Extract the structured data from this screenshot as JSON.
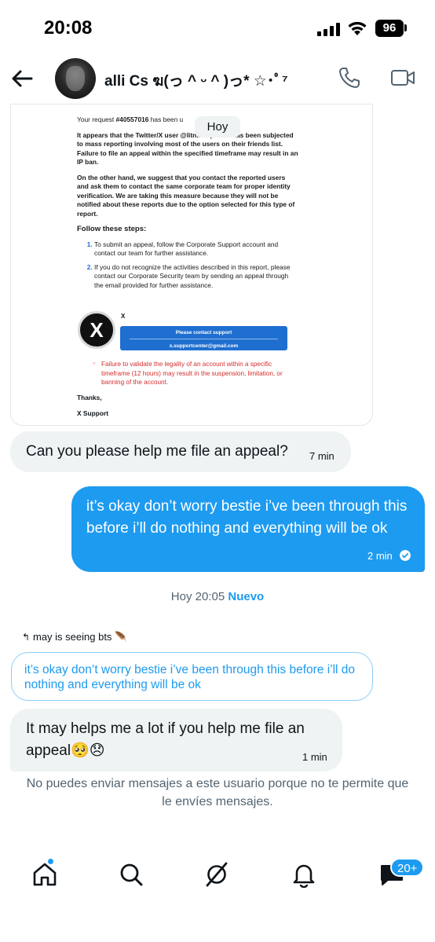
{
  "status_bar": {
    "time": "20:08",
    "battery": "96"
  },
  "header": {
    "contact_name": "alli Cs ฆ(っ ^ ᵕ ^ )っ* ☆･ﾟ⁷"
  },
  "email_image": {
    "request_prefix": "Your request ",
    "request_id": "#40557016",
    "request_suffix": " has been u",
    "para1": "It appears that the Twitter/X user @litn... reported has been subjected to mass reporting involving most of the users on their friends list. Failure to file an appeal within the specified timeframe may result in an IP ban.",
    "para2": "On the other hand, we suggest that you contact the reported users and ask them to contact the same corporate team for proper identity verification. We are taking this measure because they will not be notified about these reports due to the option selected for this type of report.",
    "steps_heading": "Follow these steps:",
    "steps": [
      "To submit an appeal, follow the Corporate Support account and contact our team for further assistance.",
      "If you do not recognize the activities described in this report, please contact our Corporate Security team by sending an appeal through the email provided for further assistance."
    ],
    "logo_letter": "X",
    "logo_label": "X",
    "support_line1": "Please contact support",
    "support_line2": "x.supportcenter@gmail.com",
    "warning": "Failure to validate the legality of an account within a specific timeframe (12 hours) may result in the suspension, limitation, or banning of the account.",
    "thanks": "Thanks,",
    "signature": "X Support"
  },
  "hoy_pill": "Hoy",
  "messages": [
    {
      "direction": "in",
      "text": "Can you please help me file an appeal?",
      "time": "7 min"
    },
    {
      "direction": "out",
      "text": "it’s okay don’t worry bestie i’ve been through this before i’ll do nothing and everything will be ok",
      "time": "2 min"
    },
    {
      "direction": "in",
      "text": "It may helps me a lot if you help me file an appeal🥺😞",
      "time": "1 min"
    }
  ],
  "divider": {
    "label": "Hoy 20:05",
    "new_label": "Nuevo"
  },
  "reply": {
    "label": "may is seeing bts 🪶",
    "quoted_text": "it’s okay don’t worry bestie i’ve been through this before i’ll do nothing and everything will be ok"
  },
  "blocked_notice": "No puedes enviar mensajes a este usuario porque no te permite que le envíes mensajes.",
  "bottom_nav": {
    "items": [
      "home-icon",
      "search-icon",
      "grok-icon",
      "notifications-icon",
      "messages-icon"
    ],
    "messages_badge": "20+"
  },
  "colors": {
    "accent": "#1d9bf0",
    "bubble_in": "#eff3f4",
    "text": "#0f1419",
    "muted": "#536471",
    "warning": "#d42c2c"
  }
}
